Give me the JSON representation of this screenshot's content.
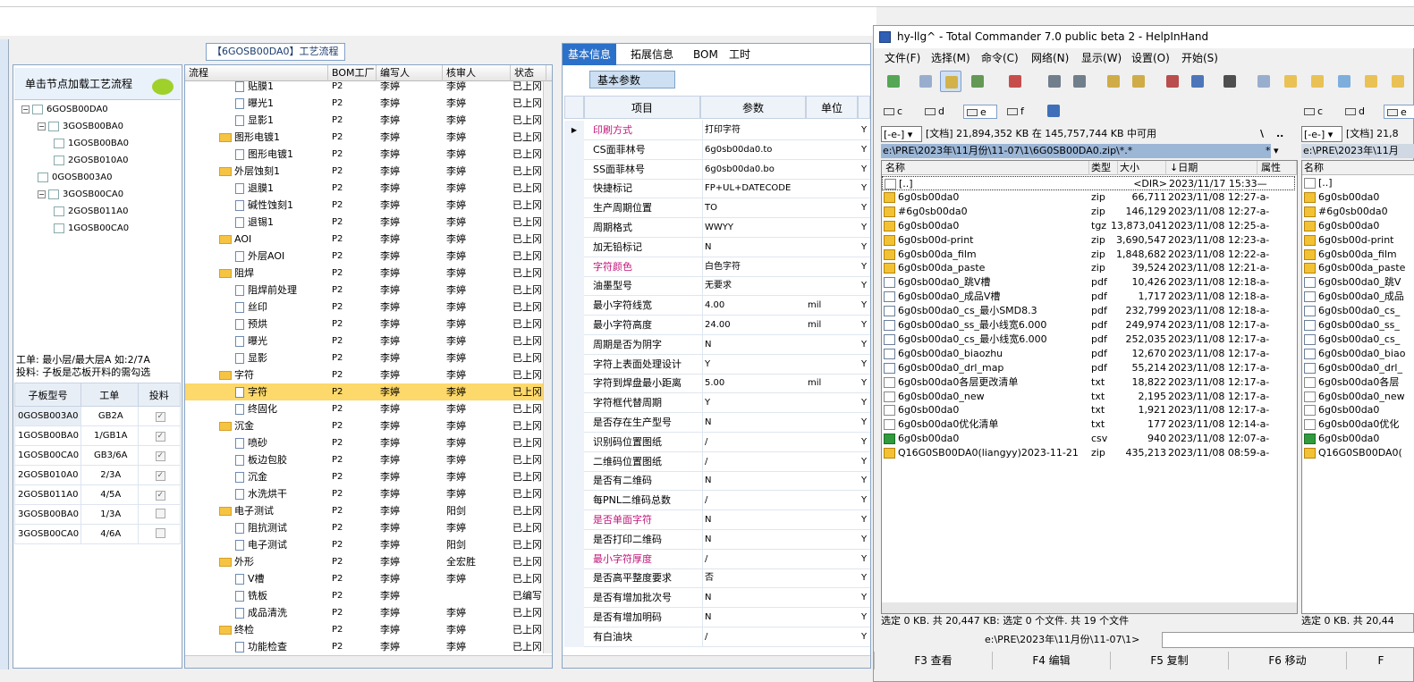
{
  "left_window": {
    "flow_title": "【6GOSB00DA0】工艺流程",
    "tip": "单击节点加载工艺流程",
    "tree": [
      {
        "label": "6GOSB00DA0",
        "level": 0
      },
      {
        "label": "3GOSB00BA0",
        "level": 1
      },
      {
        "label": "1GOSB00BA0",
        "level": 2
      },
      {
        "label": "2GOSB010A0",
        "level": 2
      },
      {
        "label": "0GOSB003A0",
        "level": 1
      },
      {
        "label": "3GOSB00CA0",
        "level": 1
      },
      {
        "label": "2GOSB011A0",
        "level": 2
      },
      {
        "label": "1GOSB00CA0",
        "level": 2
      }
    ],
    "info_line1": "工单: 最小层/最大层A 如:2/7A",
    "info_line2": "投料: 子板是芯板开料的需勾选",
    "subboard_headers": [
      "子板型号",
      "工单",
      "投料"
    ],
    "subboard_rows": [
      {
        "model": "0GOSB003A0",
        "order": "GB2A",
        "feed": "✓"
      },
      {
        "model": "1GOSB00BA0",
        "order": "1/GB1A",
        "feed": "✓"
      },
      {
        "model": "1GOSB00CA0",
        "order": "GB3/6A",
        "feed": "✓"
      },
      {
        "model": "2GOSB010A0",
        "order": "2/3A",
        "feed": "✓"
      },
      {
        "model": "2GOSB011A0",
        "order": "4/5A",
        "feed": "✓"
      },
      {
        "model": "3GOSB00BA0",
        "order": "1/3A",
        "feed": ""
      },
      {
        "model": "3GOSB00CA0",
        "order": "4/6A",
        "feed": ""
      }
    ]
  },
  "flow_table": {
    "headers": [
      "流程",
      "BOM工厂",
      "编写人",
      "核审人",
      "状态"
    ],
    "rows": [
      {
        "name": "贴膜1",
        "kind": "doc",
        "bom": "P2",
        "writer": "李婷",
        "reviewer": "李婷",
        "status": "已上冈"
      },
      {
        "name": "曝光1",
        "kind": "doc",
        "bom": "P2",
        "writer": "李婷",
        "reviewer": "李婷",
        "status": "已上冈"
      },
      {
        "name": "显影1",
        "kind": "doc",
        "bom": "P2",
        "writer": "李婷",
        "reviewer": "李婷",
        "status": "已上冈"
      },
      {
        "name": "图形电镀1",
        "kind": "folder",
        "bom": "P2",
        "writer": "李婷",
        "reviewer": "李婷",
        "status": "已上冈"
      },
      {
        "name": "图形电镀1",
        "kind": "doc",
        "bom": "P2",
        "writer": "李婷",
        "reviewer": "李婷",
        "status": "已上冈"
      },
      {
        "name": "外层蚀刻1",
        "kind": "folder",
        "bom": "P2",
        "writer": "李婷",
        "reviewer": "李婷",
        "status": "已上冈"
      },
      {
        "name": "退膜1",
        "kind": "doc",
        "bom": "P2",
        "writer": "李婷",
        "reviewer": "李婷",
        "status": "已上冈"
      },
      {
        "name": "碱性蚀刻1",
        "kind": "doc",
        "bom": "P2",
        "writer": "李婷",
        "reviewer": "李婷",
        "status": "已上冈"
      },
      {
        "name": "退锡1",
        "kind": "doc",
        "bom": "P2",
        "writer": "李婷",
        "reviewer": "李婷",
        "status": "已上冈"
      },
      {
        "name": "AOI",
        "kind": "folder",
        "bom": "P2",
        "writer": "李婷",
        "reviewer": "李婷",
        "status": "已上冈"
      },
      {
        "name": "外层AOI",
        "kind": "doc",
        "bom": "P2",
        "writer": "李婷",
        "reviewer": "李婷",
        "status": "已上冈"
      },
      {
        "name": "阻焊",
        "kind": "folder",
        "bom": "P2",
        "writer": "李婷",
        "reviewer": "李婷",
        "status": "已上冈"
      },
      {
        "name": "阻焊前处理",
        "kind": "doc",
        "bom": "P2",
        "writer": "李婷",
        "reviewer": "李婷",
        "status": "已上冈"
      },
      {
        "name": "丝印",
        "kind": "doc",
        "bom": "P2",
        "writer": "李婷",
        "reviewer": "李婷",
        "status": "已上冈"
      },
      {
        "name": "预烘",
        "kind": "doc",
        "bom": "P2",
        "writer": "李婷",
        "reviewer": "李婷",
        "status": "已上冈"
      },
      {
        "name": "曝光",
        "kind": "doc",
        "bom": "P2",
        "writer": "李婷",
        "reviewer": "李婷",
        "status": "已上冈"
      },
      {
        "name": "显影",
        "kind": "doc",
        "bom": "P2",
        "writer": "李婷",
        "reviewer": "李婷",
        "status": "已上冈"
      },
      {
        "name": "字符",
        "kind": "folder",
        "bom": "P2",
        "writer": "李婷",
        "reviewer": "李婷",
        "status": "已上冈"
      },
      {
        "name": "字符",
        "kind": "doc",
        "bom": "P2",
        "writer": "李婷",
        "reviewer": "李婷",
        "status": "已上冈",
        "selected": true
      },
      {
        "name": "终固化",
        "kind": "doc",
        "bom": "P2",
        "writer": "李婷",
        "reviewer": "李婷",
        "status": "已上冈"
      },
      {
        "name": "沉金",
        "kind": "folder",
        "bom": "P2",
        "writer": "李婷",
        "reviewer": "李婷",
        "status": "已上冈"
      },
      {
        "name": "喷砂",
        "kind": "doc",
        "bom": "P2",
        "writer": "李婷",
        "reviewer": "李婷",
        "status": "已上冈"
      },
      {
        "name": "板边包胶",
        "kind": "doc",
        "bom": "P2",
        "writer": "李婷",
        "reviewer": "李婷",
        "status": "已上冈"
      },
      {
        "name": "沉金",
        "kind": "doc",
        "bom": "P2",
        "writer": "李婷",
        "reviewer": "李婷",
        "status": "已上冈"
      },
      {
        "name": "水洗烘干",
        "kind": "doc",
        "bom": "P2",
        "writer": "李婷",
        "reviewer": "李婷",
        "status": "已上冈"
      },
      {
        "name": "电子测试",
        "kind": "folder",
        "bom": "P2",
        "writer": "李婷",
        "reviewer": "阳剑",
        "status": "已上冈"
      },
      {
        "name": "阻抗测试",
        "kind": "doc",
        "bom": "P2",
        "writer": "李婷",
        "reviewer": "李婷",
        "status": "已上冈"
      },
      {
        "name": "电子测试",
        "kind": "doc",
        "bom": "P2",
        "writer": "李婷",
        "reviewer": "阳剑",
        "status": "已上冈"
      },
      {
        "name": "外形",
        "kind": "folder",
        "bom": "P2",
        "writer": "李婷",
        "reviewer": "全宏胜",
        "status": "已上冈"
      },
      {
        "name": "V槽",
        "kind": "doc",
        "bom": "P2",
        "writer": "李婷",
        "reviewer": "李婷",
        "status": "已上冈"
      },
      {
        "name": "铣板",
        "kind": "doc",
        "bom": "P2",
        "writer": "李婷",
        "reviewer": "",
        "status": "已编写"
      },
      {
        "name": "成品清洗",
        "kind": "doc",
        "bom": "P2",
        "writer": "李婷",
        "reviewer": "李婷",
        "status": "已上冈"
      },
      {
        "name": "终检",
        "kind": "folder",
        "bom": "P2",
        "writer": "李婷",
        "reviewer": "李婷",
        "status": "已上冈"
      },
      {
        "name": "功能检查",
        "kind": "doc",
        "bom": "P2",
        "writer": "李婷",
        "reviewer": "李婷",
        "status": "已上冈"
      }
    ]
  },
  "params_panel": {
    "tabs": [
      "基本信息",
      "拓展信息",
      "BOM",
      "工时"
    ],
    "subtab": "基本参数",
    "headers": [
      "项目",
      "参数",
      "单位"
    ],
    "rows": [
      {
        "item": "印刷方式",
        "value": "打印字符",
        "unit": "",
        "flag": "Y",
        "pink": true,
        "current": true
      },
      {
        "item": "CS面菲林号",
        "value": "6g0sb00da0.to",
        "unit": "",
        "flag": "Y"
      },
      {
        "item": "SS面菲林号",
        "value": "6g0sb00da0.bo",
        "unit": "",
        "flag": "Y"
      },
      {
        "item": "快捷标记",
        "value": "FP+UL+DATECODE",
        "unit": "",
        "flag": "Y"
      },
      {
        "item": "生产周期位置",
        "value": "TO",
        "unit": "",
        "flag": "Y"
      },
      {
        "item": "周期格式",
        "value": "WWYY",
        "unit": "",
        "flag": "Y"
      },
      {
        "item": "加无铅标记",
        "value": "N",
        "unit": "",
        "flag": "Y"
      },
      {
        "item": "字符颜色",
        "value": "白色字符",
        "unit": "",
        "flag": "Y",
        "pink": true
      },
      {
        "item": "油墨型号",
        "value": "无要求",
        "unit": "",
        "flag": "Y"
      },
      {
        "item": "最小字符线宽",
        "value": "4.00",
        "unit": "mil",
        "flag": "Y"
      },
      {
        "item": "最小字符高度",
        "value": "24.00",
        "unit": "mil",
        "flag": "Y"
      },
      {
        "item": "周期是否为阴字",
        "value": "N",
        "unit": "",
        "flag": "Y"
      },
      {
        "item": "字符上表面处理设计",
        "value": "Y",
        "unit": "",
        "flag": "Y"
      },
      {
        "item": "字符到焊盘最小距离",
        "value": "5.00",
        "unit": "mil",
        "flag": "Y"
      },
      {
        "item": "字符框代替周期",
        "value": "Y",
        "unit": "",
        "flag": "Y"
      },
      {
        "item": "是否存在生产型号",
        "value": "N",
        "unit": "",
        "flag": "Y"
      },
      {
        "item": "识别码位置图纸",
        "value": "/",
        "unit": "",
        "flag": "Y"
      },
      {
        "item": "二维码位置图纸",
        "value": "/",
        "unit": "",
        "flag": "Y"
      },
      {
        "item": "是否有二维码",
        "value": "N",
        "unit": "",
        "flag": "Y"
      },
      {
        "item": "每PNL二维码总数",
        "value": "/",
        "unit": "",
        "flag": "Y"
      },
      {
        "item": "是否单面字符",
        "value": "N",
        "unit": "",
        "flag": "Y",
        "pink": true
      },
      {
        "item": "是否打印二维码",
        "value": "N",
        "unit": "",
        "flag": "Y"
      },
      {
        "item": "最小字符厚度",
        "value": "/",
        "unit": "",
        "flag": "Y",
        "pink": true
      },
      {
        "item": "是否高平整度要求",
        "value": "否",
        "unit": "",
        "flag": "Y"
      },
      {
        "item": "是否有增加批次号",
        "value": "N",
        "unit": "",
        "flag": "Y"
      },
      {
        "item": "是否有增加明码",
        "value": "N",
        "unit": "",
        "flag": "Y"
      },
      {
        "item": "有白油块",
        "value": "/",
        "unit": "",
        "flag": "Y"
      }
    ]
  },
  "total_commander": {
    "title": "hy-llg^ - Total Commander 7.0 public beta 2 - HelpInHand",
    "menu": [
      "文件(F)",
      "选择(M)",
      "命令(C)",
      "网络(N)",
      "显示(W)",
      "设置(O)",
      "开始(S)"
    ],
    "drives_left": [
      "c",
      "d",
      "e",
      "f"
    ],
    "drives_right": [
      "c",
      "d",
      "e"
    ],
    "drive_combo": "[-e-]",
    "volume_info": "[文档]  21,894,352 KB 在 145,757,744 KB 中可用",
    "volume_info_right": "[文档]  21,8",
    "path_left": "e:\\PRE\\2023年\\11月份\\11-07\\1\\6G0SB00DA0.zip\\*.*",
    "path_right": "e:\\PRE\\2023年\\11月",
    "root_btn": "\\",
    "up_btn": "..",
    "star_btn": "*",
    "col_headers": [
      "名称",
      "类型",
      "大小",
      "↓日期",
      "属性"
    ],
    "right_col_header": "名称",
    "files": [
      {
        "name": "[..]",
        "ext": "",
        "size": "<DIR>",
        "date": "2023/11/17 15:33—",
        "icon": "up"
      },
      {
        "name": "6g0sb00da0",
        "ext": "zip",
        "size": "66,711",
        "date": "2023/11/08 12:27-a-",
        "icon": "zip"
      },
      {
        "name": "#6g0sb00da0",
        "ext": "zip",
        "size": "146,129",
        "date": "2023/11/08 12:27-a-",
        "icon": "zip"
      },
      {
        "name": "6g0sb00da0",
        "ext": "tgz",
        "size": "13,873,041",
        "date": "2023/11/08 12:25-a-",
        "icon": "zip"
      },
      {
        "name": "6g0sb00d-print",
        "ext": "zip",
        "size": "3,690,547",
        "date": "2023/11/08 12:23-a-",
        "icon": "zip"
      },
      {
        "name": "6g0sb00da_film",
        "ext": "zip",
        "size": "1,848,682",
        "date": "2023/11/08 12:22-a-",
        "icon": "zip"
      },
      {
        "name": "6g0sb00da_paste",
        "ext": "zip",
        "size": "39,524",
        "date": "2023/11/08 12:21-a-",
        "icon": "zip"
      },
      {
        "name": "6g0sb00da0_跳V槽",
        "ext": "pdf",
        "size": "10,426",
        "date": "2023/11/08 12:18-a-",
        "icon": "pdf"
      },
      {
        "name": "6g0sb00da0_成品V槽",
        "ext": "pdf",
        "size": "1,717",
        "date": "2023/11/08 12:18-a-",
        "icon": "pdf"
      },
      {
        "name": "6g0sb00da0_cs_最小SMD8.3",
        "ext": "pdf",
        "size": "232,799",
        "date": "2023/11/08 12:18-a-",
        "icon": "pdf"
      },
      {
        "name": "6g0sb00da0_ss_最小线宽6.000",
        "ext": "pdf",
        "size": "249,974",
        "date": "2023/11/08 12:17-a-",
        "icon": "pdf"
      },
      {
        "name": "6g0sb00da0_cs_最小线宽6.000",
        "ext": "pdf",
        "size": "252,035",
        "date": "2023/11/08 12:17-a-",
        "icon": "pdf"
      },
      {
        "name": "6g0sb00da0_biaozhu",
        "ext": "pdf",
        "size": "12,670",
        "date": "2023/11/08 12:17-a-",
        "icon": "pdf"
      },
      {
        "name": "6g0sb00da0_drl_map",
        "ext": "pdf",
        "size": "55,214",
        "date": "2023/11/08 12:17-a-",
        "icon": "pdf"
      },
      {
        "name": "6g0sb00da0各层更改清单",
        "ext": "txt",
        "size": "18,822",
        "date": "2023/11/08 12:17-a-",
        "icon": "txt"
      },
      {
        "name": "6g0sb00da0_new",
        "ext": "txt",
        "size": "2,195",
        "date": "2023/11/08 12:17-a-",
        "icon": "txt"
      },
      {
        "name": "6g0sb00da0",
        "ext": "txt",
        "size": "1,921",
        "date": "2023/11/08 12:17-a-",
        "icon": "txt"
      },
      {
        "name": "6g0sb00da0优化清单",
        "ext": "txt",
        "size": "177",
        "date": "2023/11/08 12:14-a-",
        "icon": "txt"
      },
      {
        "name": "6g0sb00da0",
        "ext": "csv",
        "size": "940",
        "date": "2023/11/08 12:07-a-",
        "icon": "csv"
      },
      {
        "name": "Q16G0SB00DA0(liangyy)2023-11-21",
        "ext": "zip",
        "size": "435,213",
        "date": "2023/11/08 08:59-a-",
        "icon": "zip"
      }
    ],
    "right_files": [
      "[..]",
      "6g0sb00da0",
      "#6g0sb00da0",
      "6g0sb00da0",
      "6g0sb00d-print",
      "6g0sb00da_film",
      "6g0sb00da_paste",
      "6g0sb00da0_跳V",
      "6g0sb00da0_成品",
      "6g0sb00da0_cs_",
      "6g0sb00da0_ss_",
      "6g0sb00da0_cs_",
      "6g0sb00da0_biao",
      "6g0sb00da0_drl_",
      "6g0sb00da0各层",
      "6g0sb00da0_new",
      "6g0sb00da0",
      "6g0sb00da0优化",
      "6g0sb00da0",
      "Q16G0SB00DA0("
    ],
    "status_left": "选定 0 KB. 共 20,447 KB: 选定 0 个文件. 共 19 个文件",
    "status_right": "选定 0 KB. 共 20,44",
    "cmdline_path": "e:\\PRE\\2023年\\11月份\\11-07\\1>",
    "fkeys": [
      "F3 查看",
      "F4 编辑",
      "F5 复制",
      "F6 移动",
      "F"
    ]
  }
}
